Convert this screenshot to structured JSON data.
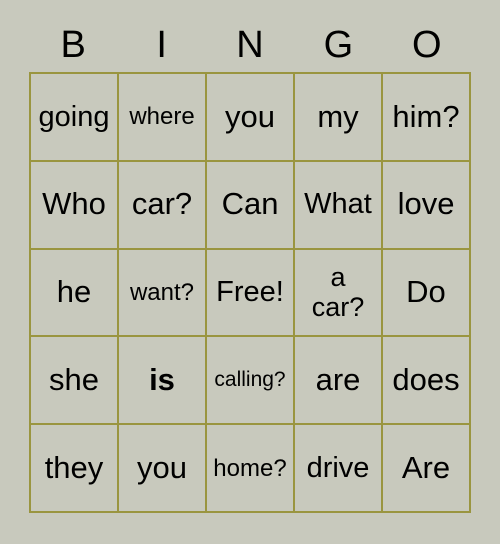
{
  "header": {
    "letters": [
      "B",
      "I",
      "N",
      "G",
      "O"
    ]
  },
  "colors": {
    "background": "#c8c9bd",
    "grid_line": "#9a9540",
    "text": "#000000"
  },
  "grid": {
    "columns": 5,
    "rows": 5,
    "cells": [
      {
        "text": "going",
        "size": "lg",
        "bold": false
      },
      {
        "text": "where",
        "size": "md",
        "bold": false
      },
      {
        "text": "you",
        "size": "xl",
        "bold": false
      },
      {
        "text": "my",
        "size": "xl",
        "bold": false
      },
      {
        "text": "him?",
        "size": "xl",
        "bold": false
      },
      {
        "text": "Who",
        "size": "xl",
        "bold": false
      },
      {
        "text": "car?",
        "size": "xl",
        "bold": false
      },
      {
        "text": "Can",
        "size": "xl",
        "bold": false
      },
      {
        "text": "What",
        "size": "lg",
        "bold": false
      },
      {
        "text": "love",
        "size": "xl",
        "bold": false
      },
      {
        "text": "he",
        "size": "xl",
        "bold": false
      },
      {
        "text": "want?",
        "size": "md",
        "bold": false
      },
      {
        "text": "Free!",
        "size": "lg",
        "bold": false
      },
      {
        "text": "a\ncar?",
        "size": "two",
        "bold": false
      },
      {
        "text": "Do",
        "size": "xl",
        "bold": false
      },
      {
        "text": "she",
        "size": "xl",
        "bold": false
      },
      {
        "text": "is",
        "size": "xl",
        "bold": true
      },
      {
        "text": "calling?",
        "size": "sm",
        "bold": false
      },
      {
        "text": "are",
        "size": "xl",
        "bold": false
      },
      {
        "text": "does",
        "size": "xl",
        "bold": false
      },
      {
        "text": "they",
        "size": "xl",
        "bold": false
      },
      {
        "text": "you",
        "size": "xl",
        "bold": false
      },
      {
        "text": "home?",
        "size": "md",
        "bold": false
      },
      {
        "text": "drive",
        "size": "lg",
        "bold": false
      },
      {
        "text": "Are",
        "size": "xl",
        "bold": false
      }
    ]
  }
}
